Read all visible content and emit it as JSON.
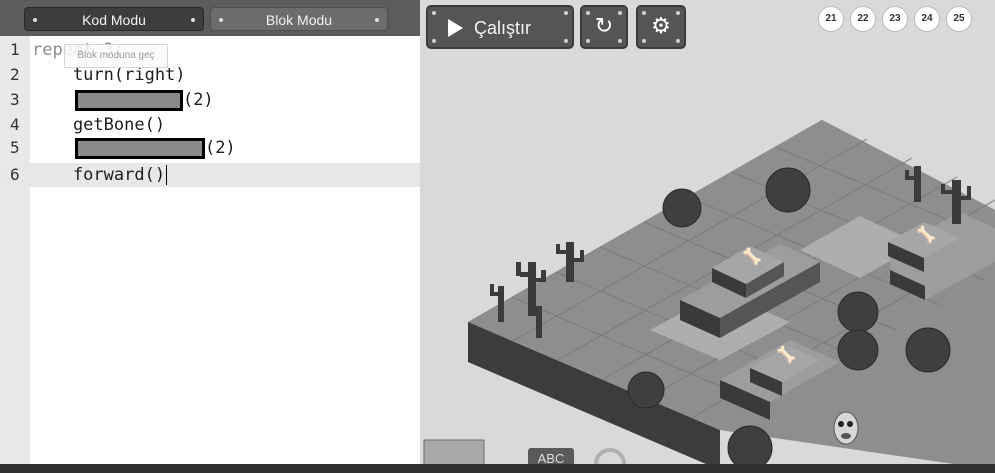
{
  "editor": {
    "mode_tabs": {
      "code": "Kod Modu",
      "blocks": "Blok Modu"
    },
    "tooltip": "Blok moduna geç",
    "lines": [
      {
        "num": "1",
        "text": "repeat 3:"
      },
      {
        "num": "2",
        "text": "    turn(right)"
      },
      {
        "num": "3",
        "text": "    ",
        "suffix": "(2)"
      },
      {
        "num": "4",
        "text": "    getBone()"
      },
      {
        "num": "5",
        "text": "    ",
        "suffix": "(2)"
      },
      {
        "num": "6",
        "text": "    forward()"
      }
    ]
  },
  "toolbar": {
    "run_label": "Çalıştır",
    "reset_icon": "reset-icon",
    "settings_icon": "gear-icon"
  },
  "levels": [
    "21",
    "22",
    "23",
    "24",
    "25"
  ],
  "bottom_tray": {
    "abc_label": "ABC"
  }
}
